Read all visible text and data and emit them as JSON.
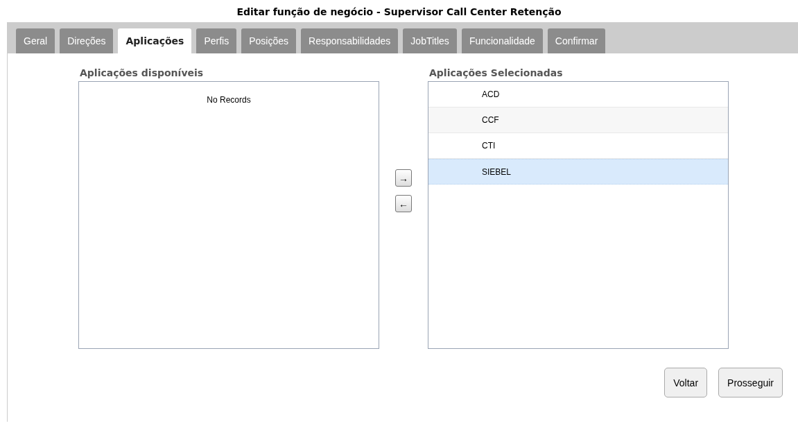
{
  "title": "Editar função de negócio - Supervisor Call Center Retenção",
  "tabs": [
    {
      "label": "Geral",
      "selected": false
    },
    {
      "label": "Direções",
      "selected": false
    },
    {
      "label": "Aplicações",
      "selected": true
    },
    {
      "label": "Perfis",
      "selected": false
    },
    {
      "label": "Posições",
      "selected": false
    },
    {
      "label": "Responsabilidades",
      "selected": false
    },
    {
      "label": "JobTitles",
      "selected": false
    },
    {
      "label": "Funcionalidade",
      "selected": false
    },
    {
      "label": "Confirmar",
      "selected": false
    }
  ],
  "available": {
    "heading": "Aplicações disponíveis",
    "empty_text": "No Records"
  },
  "selected_list": {
    "heading": "Aplicações Selecionadas",
    "items": [
      {
        "label": "ACD",
        "selected": false
      },
      {
        "label": "CCF",
        "selected": false
      },
      {
        "label": "CTI",
        "selected": false
      },
      {
        "label": "SIEBEL",
        "selected": true
      }
    ]
  },
  "transfer_buttons": [
    {
      "label": "→"
    },
    {
      "label": "←"
    }
  ],
  "buttons": [
    "Voltar",
    "Prosseguir"
  ]
}
